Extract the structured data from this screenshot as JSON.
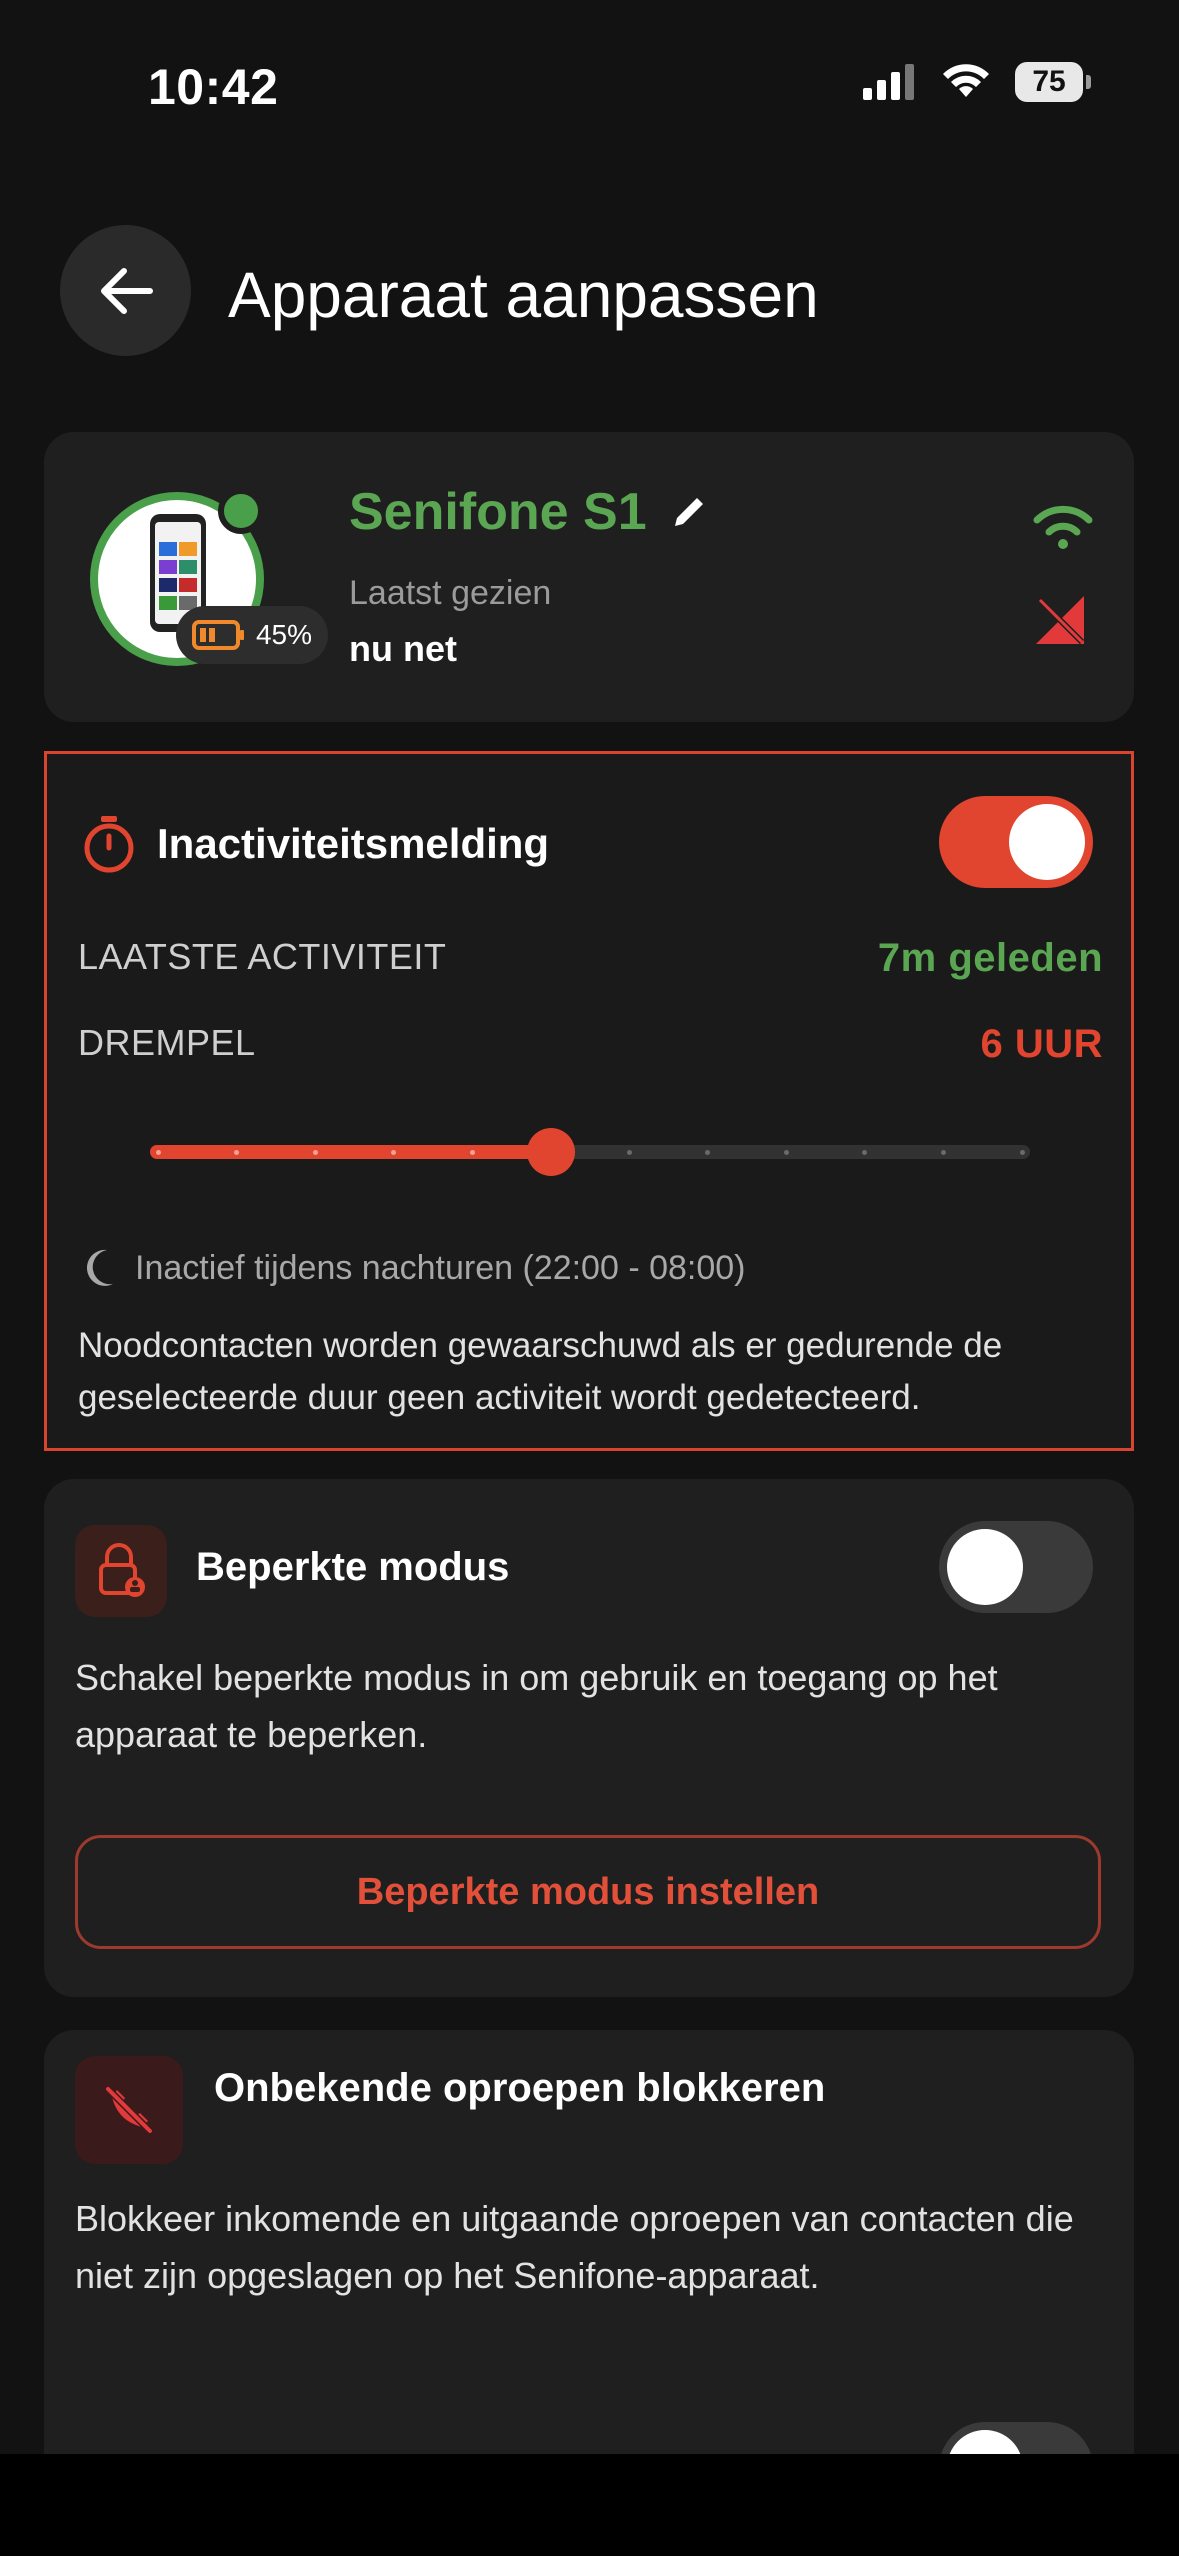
{
  "status_bar": {
    "time": "10:42",
    "battery": "75"
  },
  "header": {
    "title": "Apparaat aanpassen"
  },
  "device": {
    "name": "Senifone S1",
    "last_seen_label": "Laatst gezien",
    "last_seen_value": "nu net",
    "battery_percent": "45%",
    "wifi_color": "#5aa652",
    "no_sim_color": "#e23a3a"
  },
  "inactivity": {
    "title": "Inactiviteitsmelding",
    "enabled": true,
    "last_activity_label": "LAATSTE ACTIVITEIT",
    "last_activity_value": "7m geleden",
    "threshold_label": "DREMPEL",
    "threshold_value": "6 UUR",
    "slider": {
      "steps": 12,
      "selected_index": 5
    },
    "night_text": "Inactief tijdens nachturen (22:00 - 08:00)",
    "description": "Noodcontacten worden gewaarschuwd als er gedurende de geselecteerde duur geen activiteit wordt gedetecteerd."
  },
  "restricted_mode": {
    "title": "Beperkte modus",
    "enabled": false,
    "description": "Schakel beperkte modus in om gebruik en toegang op het apparaat te beperken.",
    "button_label": "Beperkte modus instellen"
  },
  "block_unknown": {
    "title": "Onbekende oproepen blokkeren",
    "description": "Blokkeer inkomende en uitgaande oproepen van contacten die niet zijn opgeslagen op het Senifone-apparaat."
  },
  "colors": {
    "accent": "#e1452f",
    "green": "#5aa652",
    "background": "#121212",
    "card": "#1f1f1f"
  }
}
